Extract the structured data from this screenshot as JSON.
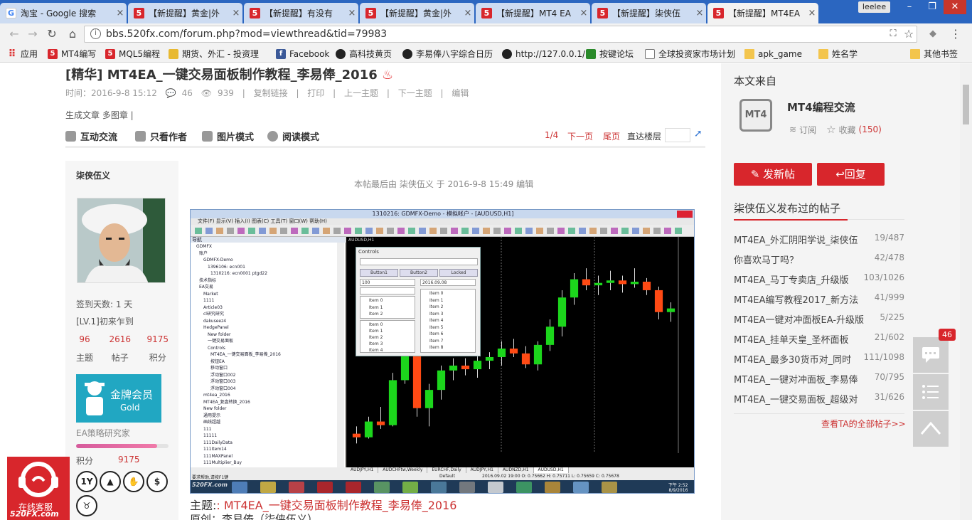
{
  "browser": {
    "tabs": [
      {
        "label": "淘宝 - Google 搜索",
        "favicon": "G"
      },
      {
        "label": "【新提醒】黄金|外",
        "favicon": "5"
      },
      {
        "label": "【新提醒】有没有",
        "favicon": "5"
      },
      {
        "label": "【新提醒】黄金|外",
        "favicon": "5"
      },
      {
        "label": "【新提醒】MT4 EA",
        "favicon": "5"
      },
      {
        "label": "【新提醒】柒侠伍",
        "favicon": "5"
      },
      {
        "label": "【新提醒】MT4EA",
        "favicon": "5"
      }
    ],
    "user": "leelee",
    "address": "bbs.520fx.com/forum.php?mod=viewthread&tid=79983",
    "bookmarks": [
      {
        "label": "应用",
        "icon": "apps-grid"
      },
      {
        "label": "MT4编写",
        "icon": "520fx"
      },
      {
        "label": "MQL5编程",
        "icon": "520fx"
      },
      {
        "label": "期货、外汇 - 投资理",
        "icon": "coin"
      },
      {
        "label": "Facebook",
        "icon": "facebook"
      },
      {
        "label": "高科技黄页",
        "icon": "globe"
      },
      {
        "label": "李易俸八字综合日历",
        "icon": "yin-yang"
      },
      {
        "label": "http://127.0.0.1/",
        "icon": "yin-yang"
      },
      {
        "label": "按键论坛",
        "icon": "key"
      },
      {
        "label": "全球投资家市场计划",
        "icon": "page"
      },
      {
        "label": "apk_game",
        "icon": "folder"
      },
      {
        "label": "姓名学",
        "icon": "folder"
      },
      {
        "label": "其他书签",
        "icon": "folder"
      }
    ]
  },
  "thread": {
    "title": "[精华] MT4EA_一键交易面板制作教程_李易俸_2016",
    "time": "时间：2016-9-8 15:12",
    "replies": "46",
    "views": "939",
    "links": [
      "复制链接",
      "打印",
      "上一主题",
      "下一主题",
      "编辑"
    ],
    "tagline": "生成文章 多图章 |",
    "toolbar": [
      "互动交流",
      "只看作者",
      "图片模式",
      "阅读模式"
    ],
    "pager": {
      "page": "1/4",
      "next": "下一页",
      "last": "尾页",
      "goto": "直达楼层"
    },
    "edit_note": "本帖最后由 柒侠伍义 于 2016-9-8 15:49 编辑",
    "subject_prefix": "主题:",
    "subject_text": ": MT4EA_一键交易面板制作教程_李易俸_2016",
    "subject2": "原创：李易俸（柒侠伍义）"
  },
  "author": {
    "name": "柒侠伍义",
    "signin_days": "签到天数: 1 天",
    "level": "[LV.1]初来乍到",
    "stats": [
      {
        "value": "96",
        "label": "主题"
      },
      {
        "value": "2616",
        "label": "帖子"
      },
      {
        "value": "9175",
        "label": "积分"
      }
    ],
    "badge_title": "金牌会员",
    "badge_sub": "Gold",
    "group": "EA策略研究家",
    "rank_progress": 0.88,
    "points_label": "积分",
    "points_value": "9175",
    "medals": [
      "1Y",
      "▲",
      "✋",
      "$",
      "♉"
    ]
  },
  "mt4": {
    "title": "1310216: GDMFX-Demo - 模拟帐户 - [AUDUSD,H1]",
    "menu": "文件(F)   显示(V)   插入(I)   图表(C)   工具(T)   窗口(W)   帮助(H)",
    "navigator_title": "导航",
    "navigator_items": [
      "GDMFX",
      "账户",
      "GDMFX-Demo",
      "1396106: ecn001",
      "1310216: ecn0001 ptgd22",
      "技术指标",
      "EA交易",
      "Market",
      "1111",
      "Article03",
      "cl研究研究",
      "dakuseez4",
      "HedgePanel",
      "New folder",
      "一键交易面板",
      "Controls",
      "MT4EA_一键交易面板_李易俸_2016",
      "按钮EA",
      "移动窗口",
      "浮动窗口002",
      "浮动窗口003",
      "浮动窗口004",
      "mt4ea_2016",
      "MT4EA_复盘转换_2016",
      "New folder",
      "通用提示",
      "画线超越",
      "111",
      "11111",
      "111DailyData",
      "111Item14",
      "111MAXPanel",
      "111Multiplier_Buy"
    ],
    "panel_title": "Controls",
    "panel_buttons": [
      "Button1",
      "Button2",
      "Locked"
    ],
    "panel_value": "100",
    "panel_date": "2016.09.08",
    "panel_list_a": [
      "Item 0",
      "Item 1",
      "Item 2"
    ],
    "panel_list_b": [
      "Item 0",
      "Item 1",
      "Item 2",
      "Item 3",
      "Item 4"
    ],
    "panel_list_c": [
      "Item 0",
      "Item 1",
      "Item 2",
      "Item 3",
      "Item 4",
      "Item 5",
      "Item 6",
      "Item 7",
      "Item 8"
    ],
    "chart_title": "AUDUSD,H1",
    "chart_tabs": [
      "AUDJPY,H1",
      "AUDCHFtw,Weekly",
      "EURCHF,Daily",
      "AUDJPY,H1",
      "AUDNZD,H1",
      "AUDUSD,H1"
    ],
    "status_left": "要求帮助,请按F1键",
    "status_default": "Default",
    "status_ohlc": "2016.09.02 19:00   O: 0.75662   H: 0.75711   L: 0.75659   C: 0.75678",
    "taskbar_time": "下午 2:52",
    "taskbar_date": "8/9/2016",
    "watermark": "520FX.com"
  },
  "sidebar": {
    "source_label": "本文来自",
    "forum_logo": "MT4",
    "forum_name": "MT4编程交流",
    "subscribe": "订阅",
    "favorite": "收藏",
    "favorite_count": "(150)",
    "new_post": "发新帖",
    "reply": "回复",
    "posts_title": "柒侠伍义发布过的帖子",
    "posts": [
      {
        "title": "MT4EA_外汇阴阳学说_柒侠伍",
        "count": "19/487"
      },
      {
        "title": "你喜欢马丁吗？",
        "count": "42/478"
      },
      {
        "title": "MT4EA_马丁专卖店_升级版",
        "count": "103/1026"
      },
      {
        "title": "MT4EA编写教程2017_新方法",
        "count": "41/999"
      },
      {
        "title": "MT4EA一键对冲面板EA-升级版",
        "count": "5/225"
      },
      {
        "title": "MT4EA_挂单天皇_圣杯面板",
        "count": "21/602"
      },
      {
        "title": "MT4EA_最多30货币对_同时",
        "count": "111/1098"
      },
      {
        "title": "MT4EA_一键对冲面板_李易俸",
        "count": "70/795"
      },
      {
        "title": "MT4EA_一键交易面板_超级对",
        "count": "31/626"
      }
    ],
    "more": "查看TA的全部帖子>>"
  },
  "floating": {
    "badge": "46",
    "service_label": "在线客服",
    "service_site": "520FX.com"
  },
  "colors": {
    "brand_red": "#d8262c",
    "chrome_blue": "#2b66c0",
    "badge_teal": "#21a7c2",
    "bull": "#1cd61c",
    "bear": "#ff4a14"
  },
  "chart_data": {
    "type": "candlestick",
    "series": [
      {
        "o": 0.7534,
        "h": 0.754,
        "l": 0.7526,
        "c": 0.7531
      },
      {
        "o": 0.7531,
        "h": 0.7548,
        "l": 0.753,
        "c": 0.7544
      },
      {
        "o": 0.7544,
        "h": 0.7556,
        "l": 0.7538,
        "c": 0.7541
      },
      {
        "o": 0.7541,
        "h": 0.7584,
        "l": 0.754,
        "c": 0.7578
      },
      {
        "o": 0.7578,
        "h": 0.7612,
        "l": 0.7575,
        "c": 0.7606
      },
      {
        "o": 0.7606,
        "h": 0.7615,
        "l": 0.7548,
        "c": 0.7555
      },
      {
        "o": 0.7555,
        "h": 0.7575,
        "l": 0.754,
        "c": 0.757
      },
      {
        "o": 0.757,
        "h": 0.759,
        "l": 0.7562,
        "c": 0.7586
      },
      {
        "o": 0.7586,
        "h": 0.7596,
        "l": 0.7578,
        "c": 0.759
      },
      {
        "o": 0.759,
        "h": 0.7596,
        "l": 0.7582,
        "c": 0.7587
      },
      {
        "o": 0.7587,
        "h": 0.76,
        "l": 0.758,
        "c": 0.7594
      },
      {
        "o": 0.7594,
        "h": 0.7601,
        "l": 0.7587,
        "c": 0.7597
      },
      {
        "o": 0.7597,
        "h": 0.761,
        "l": 0.759,
        "c": 0.7604
      },
      {
        "o": 0.7604,
        "h": 0.7612,
        "l": 0.7597,
        "c": 0.76
      },
      {
        "o": 0.76,
        "h": 0.7606,
        "l": 0.7588,
        "c": 0.7591
      },
      {
        "o": 0.7591,
        "h": 0.761,
        "l": 0.7586,
        "c": 0.7607
      },
      {
        "o": 0.7607,
        "h": 0.7628,
        "l": 0.7602,
        "c": 0.7622
      },
      {
        "o": 0.7622,
        "h": 0.7652,
        "l": 0.7614,
        "c": 0.7646
      },
      {
        "o": 0.7646,
        "h": 0.7666,
        "l": 0.764,
        "c": 0.7661
      },
      {
        "o": 0.7661,
        "h": 0.767,
        "l": 0.7652,
        "c": 0.7656
      },
      {
        "o": 0.7656,
        "h": 0.7664,
        "l": 0.7648,
        "c": 0.7658
      },
      {
        "o": 0.7658,
        "h": 0.7668,
        "l": 0.7652,
        "c": 0.766
      },
      {
        "o": 0.766,
        "h": 0.7664,
        "l": 0.765,
        "c": 0.7657
      },
      {
        "o": 0.7657,
        "h": 0.767,
        "l": 0.7654,
        "c": 0.7659
      },
      {
        "o": 0.7659,
        "h": 0.7662,
        "l": 0.7648,
        "c": 0.7652
      },
      {
        "o": 0.7652,
        "h": 0.7655,
        "l": 0.7628,
        "c": 0.7634
      },
      {
        "o": 0.7634,
        "h": 0.7642,
        "l": 0.7626,
        "c": 0.7637
      }
    ],
    "ylim": [
      0.7518,
      0.769
    ]
  }
}
